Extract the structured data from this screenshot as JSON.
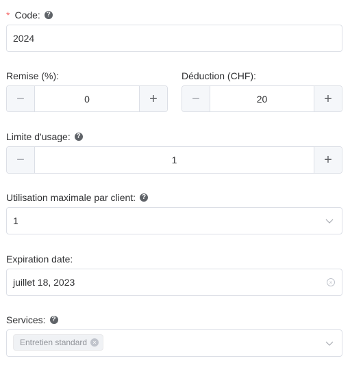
{
  "code": {
    "required_mark": "*",
    "label": "Code:",
    "help_icon": "?",
    "value": "2024"
  },
  "remise": {
    "label": "Remise (%):",
    "minus": "−",
    "plus": "+",
    "value": "0"
  },
  "deduction": {
    "label": "Déduction (CHF):",
    "minus": "−",
    "plus": "+",
    "value": "20"
  },
  "usage_limit": {
    "label": "Limite d'usage:",
    "help_icon": "?",
    "minus": "−",
    "plus": "+",
    "value": "1"
  },
  "max_per_client": {
    "label": "Utilisation maximale par client:",
    "help_icon": "?",
    "value": "1"
  },
  "expiration": {
    "label": "Expiration date:",
    "value": "juillet 18, 2023"
  },
  "services": {
    "label": "Services:",
    "help_icon": "?",
    "tags": [
      "Entretien standard"
    ],
    "tag_close": "×"
  },
  "colors": {
    "required": "#f56c6c",
    "border": "#dcdfe6",
    "stepper_bg": "#f5f7fa",
    "help_icon_bg": "#5f6368"
  }
}
